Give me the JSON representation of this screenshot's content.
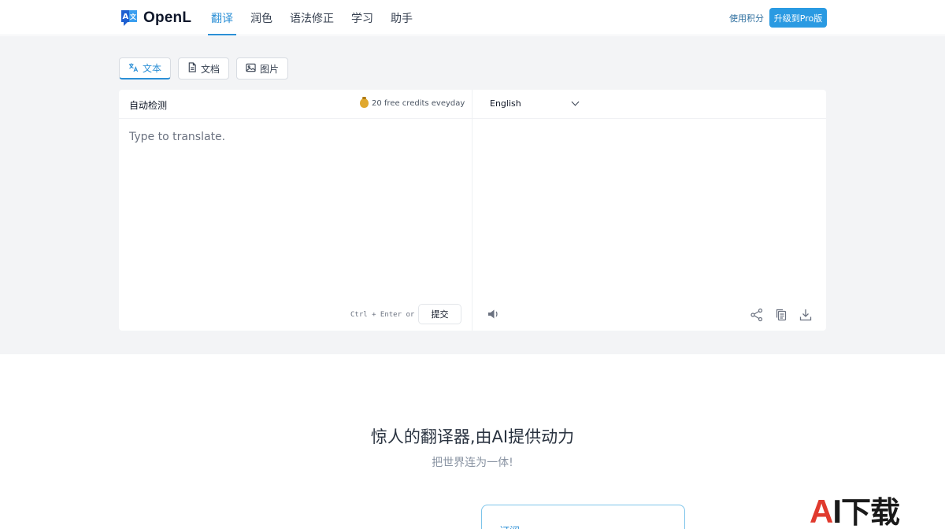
{
  "header": {
    "logo_text": "OpenL",
    "nav": [
      {
        "label": "翻译",
        "active": true
      },
      {
        "label": "润色",
        "active": false
      },
      {
        "label": "语法修正",
        "active": false
      },
      {
        "label": "学习",
        "active": false
      },
      {
        "label": "助手",
        "active": false
      }
    ],
    "credits_link": "使用积分",
    "upgrade_label": "升级到Pro版"
  },
  "modes": [
    {
      "label": "文本",
      "icon": "translate-icon",
      "active": true
    },
    {
      "label": "文档",
      "icon": "document-icon",
      "active": false
    },
    {
      "label": "图片",
      "icon": "image-icon",
      "active": false
    }
  ],
  "source": {
    "language": "自动检测",
    "free_credits": "20 free credits eveyday",
    "placeholder": "Type to translate.",
    "value": "",
    "hint": "Ctrl + Enter or",
    "submit_label": "提交"
  },
  "target": {
    "language": "English"
  },
  "hero": {
    "title": "惊人的翻译器,由AI提供动力",
    "subtitle": "把世界连为一体!"
  },
  "feature_card": {
    "title": "订阅"
  },
  "watermark": {
    "a": "A",
    "i": "I",
    "cn": "下载"
  },
  "colors": {
    "accent": "#2b8fd6",
    "upgrade_bg": "#2a9ae2",
    "workspace_bg": "#f3f4f6"
  }
}
